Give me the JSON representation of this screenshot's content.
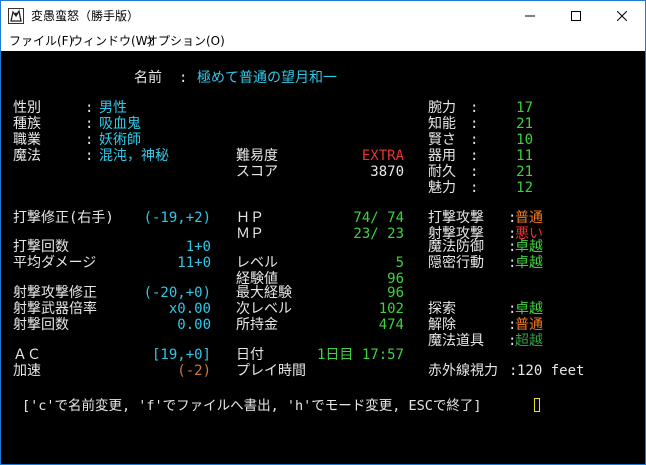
{
  "window": {
    "title": "変愚蛮怒（勝手版）",
    "menu": [
      "ファイル(F)",
      "ウィンドウ(W)",
      "オプション(O)"
    ]
  },
  "colors": {
    "cyan": "#2fc9e8",
    "green": "#3fd23f",
    "red": "#e8322e",
    "orange": "#f07a22",
    "white": "#e6e6e6"
  },
  "icons": {
    "app": "dragon-app-icon",
    "min": "minimize-icon",
    "max": "maximize-icon",
    "close": "close-icon"
  },
  "character": {
    "name_label": "名前",
    "name": "極めて普通の望月和一",
    "sex_label": "性別",
    "sex": "男性",
    "race_label": "種族",
    "race": "吸血鬼",
    "class_label": "職業",
    "class": "妖術師",
    "magic_label": "魔法",
    "magic": "混沌，神秘"
  },
  "difficulty": {
    "label": "難易度",
    "value": "EXTRA"
  },
  "score": {
    "label": "スコア",
    "value": "3870"
  },
  "stats": [
    {
      "label": "腕力",
      "value": "17"
    },
    {
      "label": "知能",
      "value": "21"
    },
    {
      "label": "賢さ",
      "value": "10"
    },
    {
      "label": "器用",
      "value": "11"
    },
    {
      "label": "耐久",
      "value": "21"
    },
    {
      "label": "魅力",
      "value": "12"
    }
  ],
  "combat": {
    "hit_mod_label": "打撃修正(右手)",
    "hit_mod": "(-19,+2)",
    "blows_label": "打撃回数",
    "blows": "1+0",
    "avg_dmg_label": "平均ダメージ",
    "avg_dmg": "11+0",
    "shoot_mod_label": "射撃攻撃修正",
    "shoot_mod": "(-20,+0)",
    "shoot_mult_label": "射撃武器倍率",
    "shoot_mult": "x0.00",
    "shots_label": "射撃回数",
    "shots": "0.00",
    "ac_label": "ＡＣ",
    "ac": "[19,+0]",
    "speed_label": "加速",
    "speed": "(-2)"
  },
  "status": {
    "hp_label": "ＨＰ",
    "hp": "74/ 74",
    "mp_label": "ＭＰ",
    "mp": "23/ 23",
    "level_label": "レベル",
    "level": "5",
    "exp_label": "経験値",
    "exp": "96",
    "max_exp_label": "最大経験",
    "max_exp": "96",
    "next_label": "次レベル",
    "next": "102",
    "gold_label": "所持金",
    "gold": "474",
    "date_label": "日付",
    "date": "1日目 17:57",
    "playtime_label": "プレイ時間",
    "playtime": ""
  },
  "skills": [
    {
      "label": "打撃攻撃",
      "value": "普通"
    },
    {
      "label": "射撃攻撃",
      "value": "悪い"
    },
    {
      "label": "魔法防御",
      "value": "卓越"
    },
    {
      "label": "隠密行動",
      "value": "卓越"
    },
    {
      "label": "探索",
      "value": "卓越"
    },
    {
      "label": "解除",
      "value": "普通"
    },
    {
      "label": "魔法道具",
      "value": "超越"
    }
  ],
  "infravision": {
    "label": "赤外線視力",
    "value": "120 feet"
  },
  "prompt": "['c'で名前変更, 'f'でファイルへ書出, 'h'でモード変更, ESCで終了]"
}
